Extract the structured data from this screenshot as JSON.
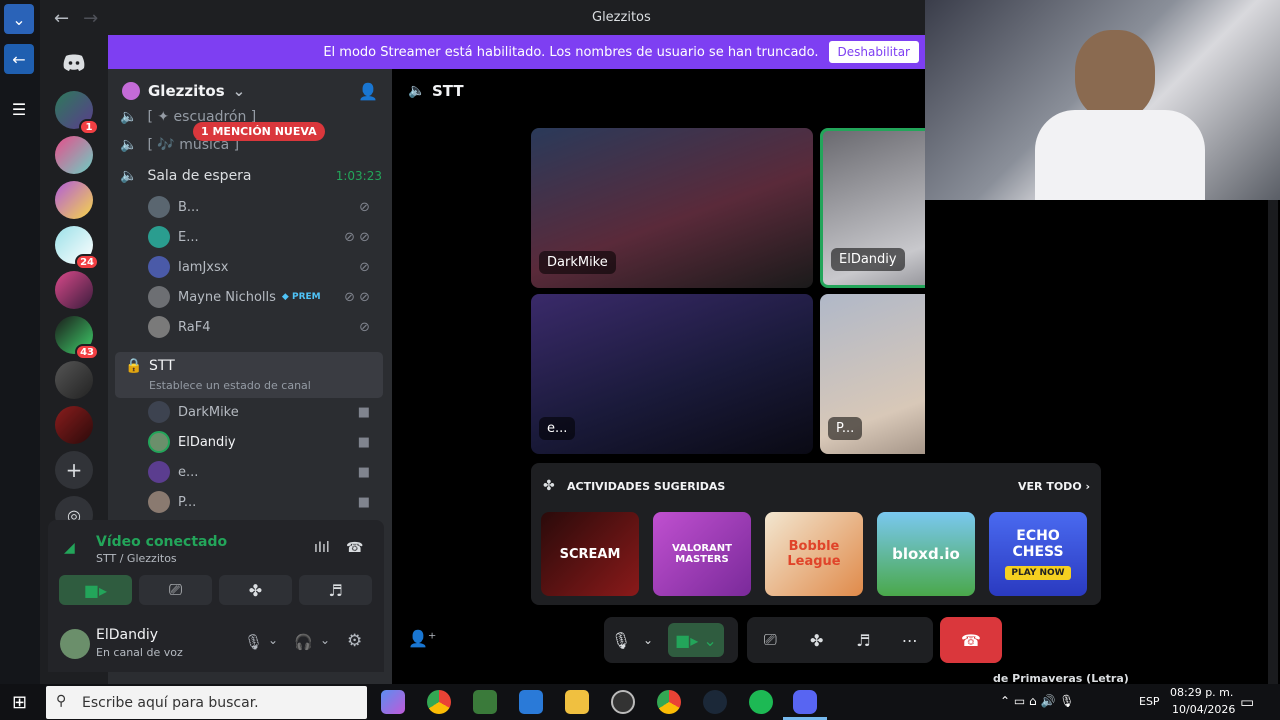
{
  "window": {
    "title": "Glezzitos"
  },
  "banner": {
    "text": "El modo Streamer está habilitado. Los nombres de usuario se han truncado.",
    "button": "Deshabilitar"
  },
  "guild_badges": [
    "1",
    "24",
    "43"
  ],
  "server": {
    "name": "Glezzitos"
  },
  "mention_pill": "1 MENCIÓN NUEVA",
  "channels": {
    "partial_1": "[ ✦ escuadrón ]",
    "partial_2": "[ 🎶 música ]",
    "waiting_room": {
      "name": "Sala de espera",
      "timer": "1:03:23"
    },
    "waiting_members": [
      "B...",
      "E...",
      "IamJxsx",
      "Mayne Nicholls",
      "RaF4"
    ],
    "prem_tag": "PREM",
    "active": {
      "name": "STT",
      "status": "Establece un estado de canal"
    },
    "stt_members": [
      "DarkMike",
      "ElDandiy",
      "e...",
      "P..."
    ]
  },
  "voice": {
    "status": "Vídeo conectado",
    "location": "STT / Glezzitos"
  },
  "user": {
    "name": "ElDandiy",
    "status": "En canal de voz"
  },
  "stage": {
    "channel": "STT",
    "tiles": [
      "DarkMike",
      "ElDandiy",
      "e...",
      "P..."
    ]
  },
  "activities": {
    "title": "ACTIVIDADES SUGERIDAS",
    "see_all": "VER TODO",
    "items": [
      "SCREAM",
      "VALORANT MASTERS",
      "Bobble League",
      "bloxd.io",
      "ECHO CHESS"
    ],
    "echo_play": "PLAY NOW"
  },
  "taskbar": {
    "search_placeholder": "Escribe aquí para buscar.",
    "lang": "ESP",
    "time": "08:29 p. m.",
    "date": "10/04/2026",
    "peek_text": "de Primaveras (Letra)"
  },
  "colors": {
    "accent": "#7e3ff2",
    "online": "#23a55a",
    "danger": "#da373c"
  }
}
